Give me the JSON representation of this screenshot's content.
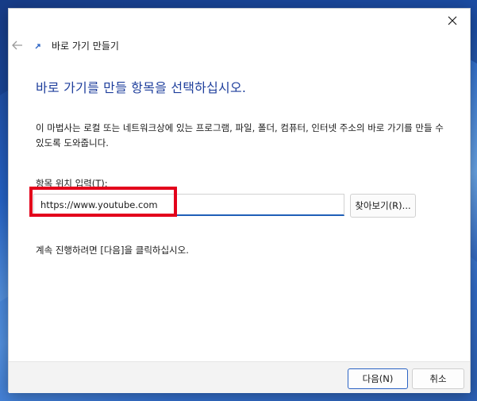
{
  "wizard": {
    "title": "바로 가기 만들기"
  },
  "content": {
    "heading": "바로 가기를 만들 항목을 선택하십시오.",
    "description": "이 마법사는 로컬 또는 네트워크상에 있는 프로그램, 파일, 폴더, 컴퓨터, 인터넷 주소의 바로 가기를 만들 수 있도록 도와줍니다.",
    "location_label": "항목 위치 입력(T):",
    "location_value": "https://www.youtube.com",
    "browse_label": "찾아보기(R)...",
    "continue_hint": "계속 진행하려면 [다음]을 클릭하십시오."
  },
  "footer": {
    "next_label": "다음(N)",
    "cancel_label": "취소"
  },
  "colors": {
    "heading": "#1f3f9c",
    "highlight": "#e3001b",
    "accent": "#2b63c4"
  },
  "icons": {
    "close": "close-icon",
    "back": "back-arrow-icon",
    "shortcut": "shortcut-icon"
  }
}
